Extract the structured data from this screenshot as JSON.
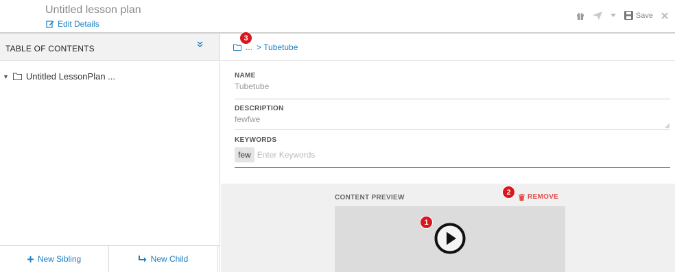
{
  "header": {
    "title": "Untitled lesson plan",
    "edit_label": "Edit Details",
    "save_label": "Save"
  },
  "sidebar": {
    "toc_title": "TABLE OF CONTENTS",
    "tree": [
      {
        "label": "Untitled LessonPlan ..."
      }
    ],
    "new_sibling_label": "New Sibling",
    "new_child_label": "New Child"
  },
  "breadcrumb": {
    "ellipsis": "...",
    "current": "> Tubetube"
  },
  "form": {
    "name_label": "NAME",
    "name_value": "Tubetube",
    "description_label": "DESCRIPTION",
    "description_value": "fewfwe",
    "keywords_label": "KEYWORDS",
    "keywords": [
      "few"
    ],
    "keywords_placeholder": "Enter Keywords"
  },
  "preview": {
    "label": "CONTENT PREVIEW",
    "remove_label": "REMOVE"
  },
  "badges": [
    "1",
    "2",
    "3"
  ],
  "colors": {
    "link": "#1a7fc4",
    "remove": "#e05050",
    "badge": "#d9161d"
  }
}
